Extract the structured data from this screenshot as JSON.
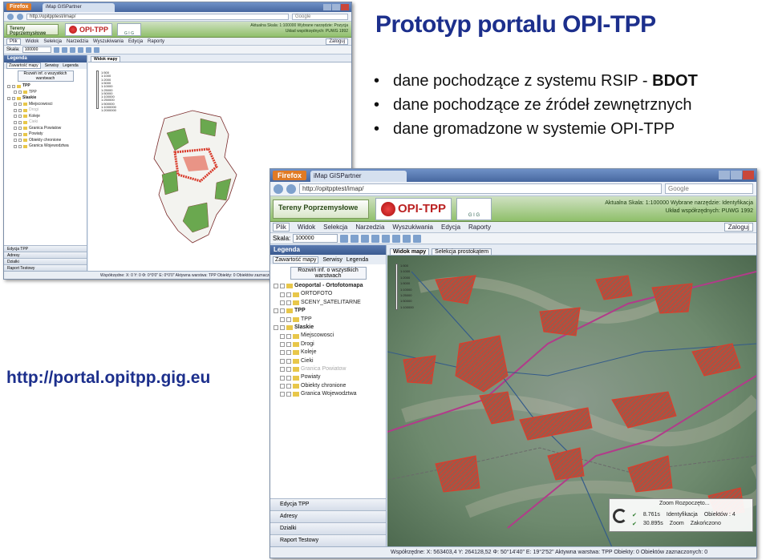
{
  "slide": {
    "title": "Prototyp portalu OPI-TPP",
    "bullets": [
      {
        "text": "dane pochodzące z systemu RSIP - ",
        "bold": "BDOT"
      },
      {
        "text": "dane pochodzące ze źródeł zewnętrznych",
        "bold": ""
      },
      {
        "text": "dane gromadzone w systemie OPI-TPP",
        "bold": ""
      }
    ],
    "url": "http://portal.opitpp.gig.eu"
  },
  "browser1": {
    "ff_button": "Firefox",
    "tab_title": "iMap GISPartner",
    "address": "http://opitpptest/imap/",
    "search_placeholder": "Google",
    "context_label": "Tereny Poprzemysłowe",
    "logo_text": "OPI-TPP",
    "gig_text": "G I G",
    "header_info": [
      "Aktualna Skala: 1:100000   Wybrane narzędzie: Pozycja",
      "Układ współrzędnych: PUWG 1992"
    ],
    "menu": [
      "Plik",
      "Widok",
      "Selekcja",
      "Narzedzia",
      "Wyszukiwania",
      "Edycja",
      "Raporty"
    ],
    "logout": "Zaloguj",
    "scale_label": "Skala:",
    "scale_value": "100000",
    "panel_title": "Legenda",
    "panel_tabs": [
      "Zawartość mapy",
      "Serwisy",
      "Legenda"
    ],
    "panel_button": "Rozwiń inf. o wszystkich warstwach",
    "tree": [
      {
        "label": "TPP",
        "level": 1,
        "bold": true,
        "disabled": false
      },
      {
        "label": "TPP",
        "level": 2,
        "bold": false,
        "disabled": false
      },
      {
        "label": "Slaskie",
        "level": 1,
        "bold": true,
        "disabled": false
      },
      {
        "label": "Miejscowosci",
        "level": 2,
        "bold": false,
        "disabled": false
      },
      {
        "label": "Drogi",
        "level": 2,
        "bold": false,
        "disabled": true
      },
      {
        "label": "Koleje",
        "level": 2,
        "bold": false,
        "disabled": false
      },
      {
        "label": "Cieki",
        "level": 2,
        "bold": false,
        "disabled": true
      },
      {
        "label": "Granica Powiatow",
        "level": 2,
        "bold": false,
        "disabled": false
      },
      {
        "label": "Powiaty",
        "level": 2,
        "bold": false,
        "disabled": false
      },
      {
        "label": "Obiekty chronione",
        "level": 2,
        "bold": false,
        "disabled": false
      },
      {
        "label": "Granica Wojewodztwa",
        "level": 2,
        "bold": false,
        "disabled": false
      }
    ],
    "accordion": [
      "Edycja TPP",
      "Adresy",
      "Dzialki",
      "Raport Testowy"
    ],
    "map_tabs": [
      "Widok mapy"
    ],
    "zoom_labels": [
      "1:500",
      "1:1000",
      "1:2000",
      "1:5000",
      "1:10000",
      "1:25000",
      "1:50000",
      "1:100000",
      "1:250000",
      "1:500000",
      "1:1000000",
      "1:2000000"
    ],
    "status": "Współrzędne: X: 0 Y: 0 Φ: 0°0'0\" E: 0°0'0\"   Aktywna warstwa: TPP   Obiekty: 0   Obiektów zaznaczonych: 0"
  },
  "browser2": {
    "ff_button": "Firefox",
    "tab_title": "iMap GISPartner",
    "address": "http://opitpptest/imap/",
    "search_placeholder": "Google",
    "context_label": "Tereny Poprzemysłowe",
    "logo_text": "OPI-TPP",
    "gig_text": "G I G",
    "header_info": [
      "Aktualna Skala: 1:100000   Wybrane narzędzie: Identyfikacja",
      "Układ współrzędnych: PUWG 1992"
    ],
    "menu": [
      "Plik",
      "Widok",
      "Selekcja",
      "Narzedzia",
      "Wyszukiwania",
      "Edycja",
      "Raporty"
    ],
    "logout": "Zaloguj",
    "scale_label": "Skala:",
    "scale_value": "100000",
    "panel_title": "Legenda",
    "panel_tabs": [
      "Zawartość mapy",
      "Serwisy",
      "Legenda"
    ],
    "panel_button": "Rozwiń inf. o wszystkich warstwach",
    "tree": [
      {
        "label": "Geoportal - Ortofotomapa",
        "level": 1,
        "bold": true,
        "disabled": false
      },
      {
        "label": "ORTOFOTO",
        "level": 2,
        "bold": false,
        "disabled": false
      },
      {
        "label": "SCENY_SATELITARNE",
        "level": 2,
        "bold": false,
        "disabled": false
      },
      {
        "label": "TPP",
        "level": 1,
        "bold": true,
        "disabled": false
      },
      {
        "label": "TPP",
        "level": 2,
        "bold": false,
        "disabled": false
      },
      {
        "label": "Slaskie",
        "level": 1,
        "bold": true,
        "disabled": false
      },
      {
        "label": "Miejscowosci",
        "level": 2,
        "bold": false,
        "disabled": false
      },
      {
        "label": "Drogi",
        "level": 2,
        "bold": false,
        "disabled": false
      },
      {
        "label": "Koleje",
        "level": 2,
        "bold": false,
        "disabled": false
      },
      {
        "label": "Cieki",
        "level": 2,
        "bold": false,
        "disabled": false
      },
      {
        "label": "Granica Powiatow",
        "level": 2,
        "bold": false,
        "disabled": true
      },
      {
        "label": "Powiaty",
        "level": 2,
        "bold": false,
        "disabled": false
      },
      {
        "label": "Obiekty chronione",
        "level": 2,
        "bold": false,
        "disabled": false
      },
      {
        "label": "Granica Wojewodztwa",
        "level": 2,
        "bold": false,
        "disabled": false
      }
    ],
    "accordion": [
      "Edycja TPP",
      "Adresy",
      "Dzialki",
      "Raport Testowy"
    ],
    "map_tabs": [
      "Widok mapy",
      "Selekcja prostokątem"
    ],
    "zoom_labels": [
      "1:500",
      "1:1000",
      "1:2000",
      "1:5000",
      "1:10000",
      "1:25000",
      "1:50000",
      "1:100000"
    ],
    "zoom_panel": {
      "title": "Zoom   Rozpoczęto...",
      "rows": [
        {
          "time": "8.761s",
          "action": "Identyfikacja",
          "status": "Obiektów : 4"
        },
        {
          "time": "30.895s",
          "action": "Zoom",
          "status": "Zakończono"
        }
      ]
    },
    "status": "Współrzędne: X: 563403,4 Y: 264128,52   Φ: 50°14'40\" E: 19°2'52\"   Aktywna warstwa: TPP   Obiekty: 0   Obiektów zaznaczonych: 0"
  },
  "colors": {
    "title": "#1c2f8c",
    "tpp_polygons": "#d83a2a",
    "region_green": "#6aa84f",
    "header_green": "#8fbf6a"
  }
}
